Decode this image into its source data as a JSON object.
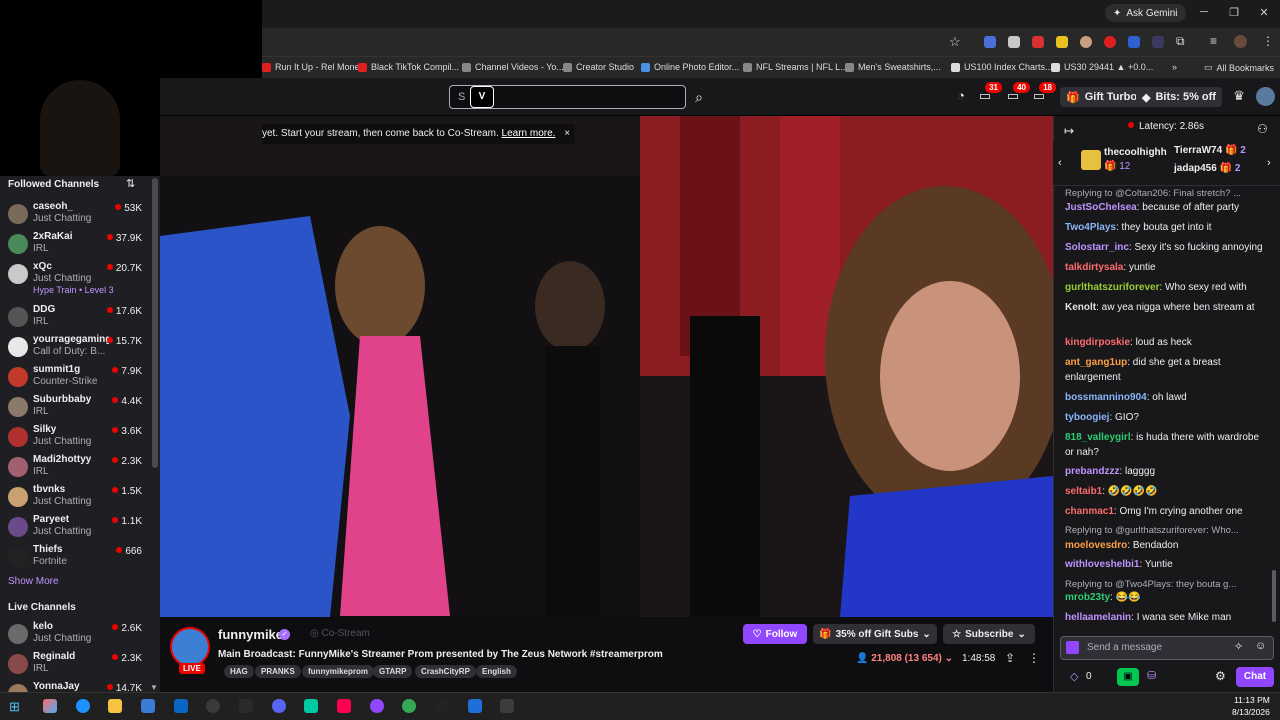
{
  "browser": {
    "gemini_label": "Ask Gemini",
    "bookmarks": [
      "Run It Up - Rel Money",
      "Black TikTok Compil...",
      "Channel Videos - Yo...",
      "Creator Studio",
      "Online Photo Editor...",
      "NFL Streams | NFL L...",
      "Men's Sweatshirts,...",
      "US100 Index Charts...",
      "US30 29441 ▲ +0.0..."
    ],
    "all_bookmarks": "All Bookmarks",
    "more": "»"
  },
  "twitch_nav": {
    "search_placeholder": "S",
    "badges": {
      "whispers": "31",
      "notifications": "40",
      "inbox": "18"
    },
    "gift_turbo": "Gift Turbo",
    "bits": "Bits: 5% off"
  },
  "notice": {
    "text": "yet. Start your stream, then come back to Co-Stream.",
    "link": "Learn more.",
    "close": "×"
  },
  "sidebar": {
    "followed_title": "Followed Channels",
    "followed": [
      {
        "name": "caseoh_",
        "game": "Just Chatting",
        "viewers": "53K",
        "color": "#7a6a5a"
      },
      {
        "name": "2xRaKai",
        "game": "IRL",
        "viewers": "37.9K",
        "color": "#4a8a5a"
      },
      {
        "name": "xQc",
        "game": "Just Chatting",
        "viewers": "20.7K",
        "extra": "Hype Train • Level 3",
        "color": "#c9c9c9"
      },
      {
        "name": "DDG",
        "game": "IRL",
        "viewers": "17.6K",
        "color": "#555"
      },
      {
        "name": "yourragegaming",
        "game": "Call of Duty: B...",
        "viewers": "15.7K",
        "color": "#e8e8e8"
      },
      {
        "name": "summit1g",
        "game": "Counter-Strike",
        "viewers": "7.9K",
        "color": "#c0392b"
      },
      {
        "name": "Suburbbaby",
        "game": "IRL",
        "viewers": "4.4K",
        "color": "#8a7a6a"
      },
      {
        "name": "Silky",
        "game": "Just Chatting",
        "viewers": "3.6K",
        "color": "#b03030"
      },
      {
        "name": "Madi2hottyy",
        "game": "IRL",
        "viewers": "2.3K",
        "color": "#a06070"
      },
      {
        "name": "tbvnks",
        "game": "Just Chatting",
        "viewers": "1.5K",
        "color": "#c9a070"
      },
      {
        "name": "Paryeet",
        "game": "Just Chatting",
        "viewers": "1.1K",
        "color": "#6a4a8a"
      },
      {
        "name": "Thiefs",
        "game": "Fortnite",
        "viewers": "666",
        "color": "#222"
      }
    ],
    "show_more": "Show More",
    "live_title": "Live Channels",
    "live": [
      {
        "name": "kelo",
        "game": "Just Chatting",
        "viewers": "2.6K",
        "color": "#6a6a6a"
      },
      {
        "name": "Reginald",
        "game": "IRL",
        "viewers": "2.3K",
        "color": "#8a4a4a"
      },
      {
        "name": "YonnaJay",
        "game": "",
        "viewers": "14.7K",
        "color": "#9a7a5a"
      }
    ]
  },
  "stream": {
    "streamer": "funnymike",
    "live_badge": "LIVE",
    "costream": "Co-Stream",
    "title": "Main Broadcast: FunnyMike's Streamer Prom presented by The Zeus Network #streamerprom",
    "tags": [
      "HAG",
      "PRANKS",
      "funnymikeprom",
      "GTARP",
      "CrashCityRP",
      "English"
    ],
    "follow": "Follow",
    "gift_subs": "35% off Gift Subs",
    "subscribe": "Subscribe",
    "viewers": "21,808 (13 654)",
    "uptime": "1:48:58"
  },
  "chat": {
    "latency": "Latency: 2.86s",
    "gifters": [
      {
        "name": "thecoolhighh",
        "count": "12"
      },
      {
        "name": "TierraW74",
        "count": "2"
      },
      {
        "name": "jadap456",
        "count": "2"
      }
    ],
    "messages": [
      {
        "reply": "Replying to @Coltan206: Final stretch? ..."
      },
      {
        "user": "JustSoChelsea",
        "color": "#bf94ff",
        "text": "because of after party"
      },
      {
        "user": "Two4Plays",
        "color": "#8ab4f8",
        "text": "they bouta get into it"
      },
      {
        "user": "Solostarr_inc",
        "color": "#bf94ff",
        "text": "Sexy it's so fucking annoying"
      },
      {
        "user": "talkdirtysala",
        "color": "#ff6b6b",
        "text": "yuntie"
      },
      {
        "user": "gurlthatszuriforever",
        "color": "#9acd32",
        "text": "Who sexy red with"
      },
      {
        "user": "Kenolt",
        "color": "#e0e0e0",
        "text": "aw yea nigga where ben stream at"
      },
      {
        "user": "kingdirposkie",
        "color": "#ff6b6b",
        "text": "loud as heck"
      },
      {
        "user": "ant_gang1up",
        "color": "#ff9f43",
        "text": "did she get a breast enlargement"
      },
      {
        "user": "bossmannino904",
        "color": "#8ab4f8",
        "text": "oh lawd"
      },
      {
        "user": "tyboogiej",
        "color": "#8ab4f8",
        "text": "GIO?"
      },
      {
        "user": "818_valleygirl",
        "color": "#2ecc71",
        "text": "is huda there with wardrobe or nah?"
      },
      {
        "user": "prebandzzz",
        "color": "#bf94ff",
        "text": "lagggg"
      },
      {
        "user": "seltaib1",
        "color": "#ff6b6b",
        "text": "🤣🤣🤣🤣"
      },
      {
        "user": "chanmac1",
        "color": "#ff6b6b",
        "text": "Omg I'm crying another one"
      },
      {
        "reply": "Replying to @gurlthatszuriforever: Who..."
      },
      {
        "user": "moelovesdro",
        "color": "#ff9f43",
        "text": "Bendadon"
      },
      {
        "user": "withloveshelbi1",
        "color": "#bf94ff",
        "text": "Yuntie"
      },
      {
        "reply": "Replying to @Two4Plays: they bouta g..."
      },
      {
        "user": "mrob23ty",
        "color": "#2ecc71",
        "text": "😂😂"
      },
      {
        "user": "hellaamelanin",
        "color": "#bf94ff",
        "text": "I wana see Mike man"
      }
    ],
    "input_placeholder": "Send a message",
    "points": "0",
    "chat_button": "Chat"
  },
  "taskbar": {
    "time": "11:13 PM",
    "date": "8/13/2026"
  }
}
